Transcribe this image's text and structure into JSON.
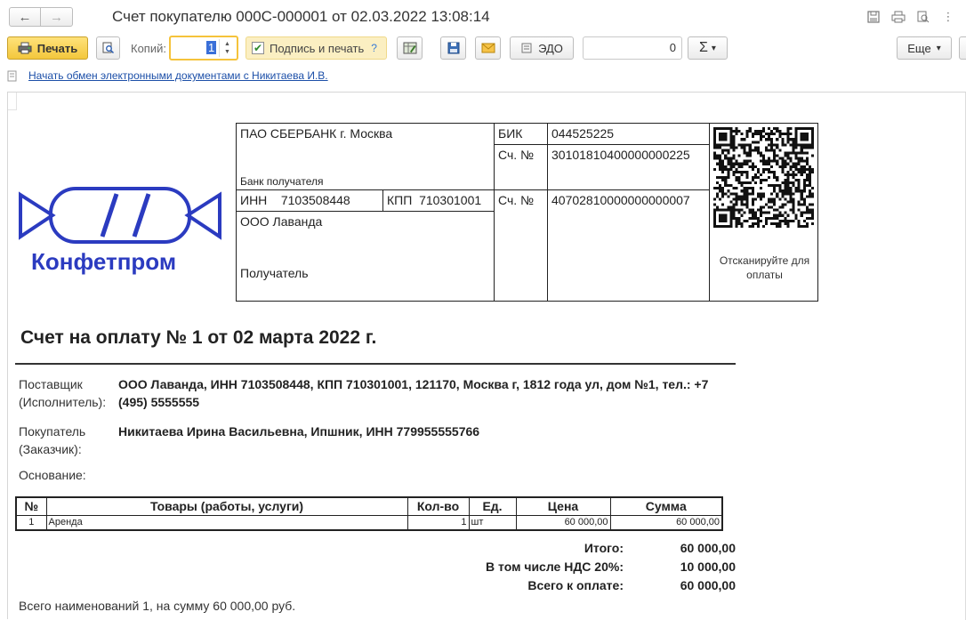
{
  "window": {
    "title": "Счет покупателю 000С-000001 от 02.03.2022 13:08:14",
    "back_icon": "arrow-left-icon",
    "forward_icon": "arrow-right-icon"
  },
  "toolbar": {
    "print_label": "Печать",
    "copies_label": "Копий:",
    "copies_value": "1",
    "sign_label": "Подпись и печать",
    "sign_checked": true,
    "help_label": "?",
    "edo_label": "ЭДО",
    "sum_value": "0",
    "sigma_label": "Σ",
    "more_label": "Еще",
    "dropdown_glyph": "▾"
  },
  "link": {
    "text": "Начать обмен электронными документами с Никитаева И.В."
  },
  "document": {
    "logo_text": "Конфетпром",
    "bank": {
      "bank_name": "ПАО СБЕРБАНК г. Москва",
      "bank_caption": "Банк получателя",
      "bik_label": "БИК",
      "bik_value": "044525225",
      "corr_label": "Сч. №",
      "corr_value": "30101810400000000225",
      "inn_label": "ИНН",
      "inn_value": "7103508448",
      "kpp_label": "КПП",
      "kpp_value": "710301001",
      "account_label": "Сч. №",
      "account_value": "40702810000000000007",
      "recipient_name": "ООО Лаванда",
      "recipient_caption": "Получатель"
    },
    "qr_caption": "Отсканируйте для оплаты",
    "title": "Счет на оплату № 1 от 02 марта 2022 г.",
    "supplier_label": "Поставщик (Исполнитель):",
    "supplier_value": "ООО Лаванда, ИНН 7103508448, КПП 710301001, 121170, Москва г, 1812 года ул, дом №1, тел.: +7 (495) 5555555",
    "buyer_label": "Покупатель (Заказчик):",
    "buyer_value": "Никитаева Ирина Васильевна, Ипшник, ИНН 779955555766",
    "basis_label": "Основание:",
    "table": {
      "headers": [
        "№",
        "Товары (работы, услуги)",
        "Кол-во",
        "Ед.",
        "Цена",
        "Сумма"
      ],
      "rows": [
        [
          "1",
          "Аренда",
          "1",
          "шт",
          "60 000,00",
          "60 000,00"
        ]
      ]
    },
    "totals": [
      {
        "label": "Итого:",
        "value": "60 000,00"
      },
      {
        "label": "В том числе НДС 20%:",
        "value": "10 000,00"
      },
      {
        "label": "Всего к оплате:",
        "value": "60 000,00"
      }
    ],
    "summary": "Всего наименований 1, на сумму 60 000,00 руб."
  },
  "colors": {
    "print_button": "#f3c73c",
    "sign_button_bg": "#fbefc2",
    "logo_blue": "#2b3bc0",
    "link_blue": "#1c4fa8"
  }
}
